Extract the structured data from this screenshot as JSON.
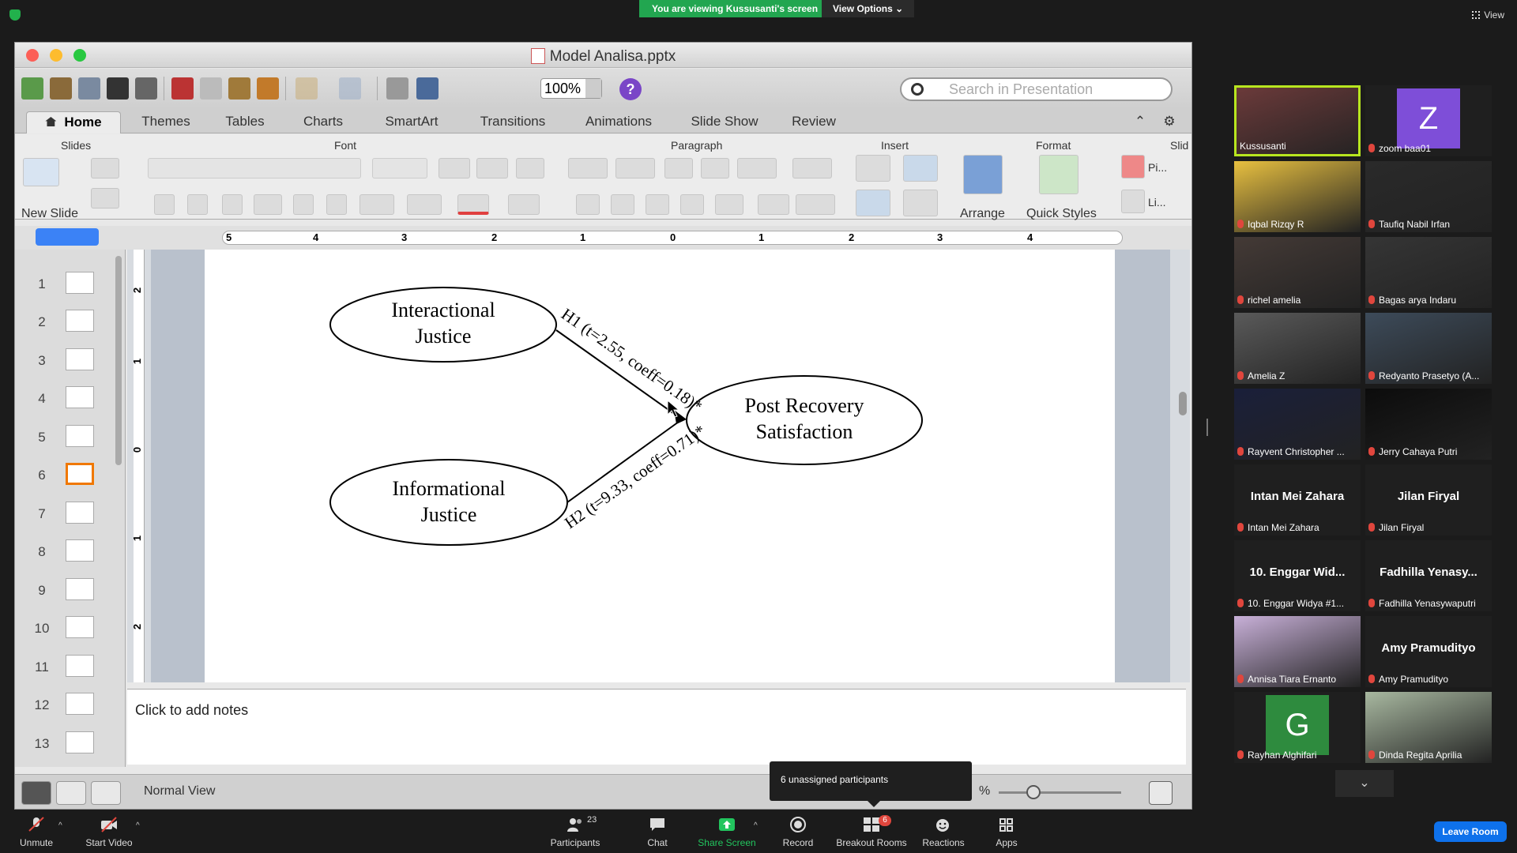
{
  "zoom_top": {
    "viewing_banner": "You are viewing Kussusanti's screen",
    "view_options": "View Options",
    "view_label": "View"
  },
  "ppt": {
    "title": "Model Analisa.pptx",
    "zoom": "100%",
    "search_placeholder": "Search in Presentation",
    "tabs": [
      "Home",
      "Themes",
      "Tables",
      "Charts",
      "SmartArt",
      "Transitions",
      "Animations",
      "Slide Show",
      "Review"
    ],
    "ribbon_groups": {
      "slides": "Slides",
      "font": "Font",
      "paragraph": "Paragraph",
      "insert": "Insert",
      "format": "Format",
      "slide_cut": "Slid"
    },
    "new_slide": "New Slide",
    "arrange": "Arrange",
    "quick_styles": "Quick Styles",
    "pi_label": "Pi...",
    "li_label": "Li...",
    "ruler_numbers": [
      "5",
      "4",
      "3",
      "2",
      "1",
      "0",
      "1",
      "2",
      "3",
      "4"
    ],
    "vruler_numbers": [
      "2",
      "1",
      "0",
      "1",
      "2"
    ],
    "slide_numbers": [
      "1",
      "2",
      "3",
      "4",
      "5",
      "6",
      "7",
      "8",
      "9",
      "10",
      "11",
      "12",
      "13"
    ],
    "selected_slide": "6",
    "diagram": {
      "node1_line1": "Interactional",
      "node1_line2": "Justice",
      "node2_line1": "Informational",
      "node2_line2": "Justice",
      "node3_line1": "Post Recovery",
      "node3_line2": "Satisfaction",
      "h1": "H1 (t=2.55, coeff=0.18)*",
      "h2": "H2 (t=9.33, coeff=0.71)*"
    },
    "notes_placeholder": "Click to add notes",
    "status_view": "Normal View",
    "zoom_pct_fragment": "%"
  },
  "tooltip": "6 unassigned participants",
  "participants": [
    {
      "name": "Kussusanti",
      "display": "video",
      "active": true
    },
    {
      "name": "zoom baa01",
      "display": "letter",
      "letter": "Z",
      "color": "#7e4ed8"
    },
    {
      "name": "Iqbal Rizqy R",
      "display": "video"
    },
    {
      "name": "Taufiq Nabil Irfan",
      "display": "video"
    },
    {
      "name": "richel amelia",
      "display": "video"
    },
    {
      "name": "Bagas arya Indaru",
      "display": "video"
    },
    {
      "name": "Amelia Z",
      "display": "video"
    },
    {
      "name": "Redyanto Prasetyo (A...",
      "display": "video"
    },
    {
      "name": "Rayvent Christopher ...",
      "display": "video"
    },
    {
      "name": "Jerry Cahaya Putri",
      "display": "video"
    },
    {
      "name": "Intan Mei Zahara",
      "display": "text",
      "big": "Intan Mei Zahara"
    },
    {
      "name": "Jilan Firyal",
      "display": "text",
      "big": "Jilan Firyal"
    },
    {
      "name": "10. Enggar Widya #1...",
      "display": "text",
      "big": "10. Enggar Wid..."
    },
    {
      "name": "Fadhilla Yenasywaputri",
      "display": "text",
      "big": "Fadhilla Yenasy..."
    },
    {
      "name": "Annisa Tiara Ernanto",
      "display": "video"
    },
    {
      "name": "Amy Pramudityo",
      "display": "text",
      "big": "Amy Pramudityo"
    },
    {
      "name": "Rayhan Alghifari",
      "display": "letter",
      "letter": "G",
      "color": "#2e8b3e"
    },
    {
      "name": "Dinda Regita Aprilia",
      "display": "video"
    }
  ],
  "zoom_bottom": {
    "unmute": "Unmute",
    "start_video": "Start Video",
    "participants": "Participants",
    "participant_count": "23",
    "chat": "Chat",
    "share_screen": "Share Screen",
    "record": "Record",
    "breakout_rooms": "Breakout Rooms",
    "breakout_badge": "6",
    "reactions": "Reactions",
    "apps": "Apps",
    "leave_room": "Leave Room"
  },
  "colors": {
    "zoom_green": "#22a650",
    "active_speaker": "#b8e61f",
    "leave_blue": "#0e71eb",
    "slide_selected": "#f07800"
  }
}
